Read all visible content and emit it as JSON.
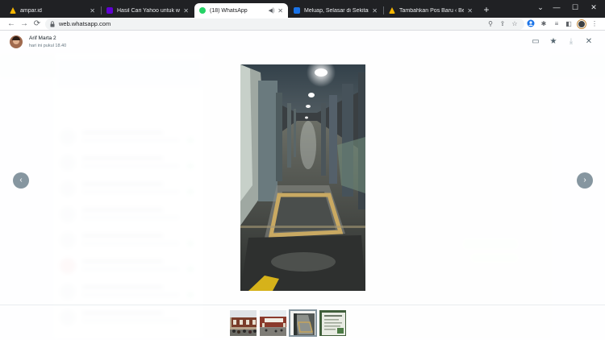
{
  "browser": {
    "tabs": [
      {
        "title": "ampar.id",
        "favicon_color": "#f6b600"
      },
      {
        "title": "Hasil Cari Yahoo untuk whatsapp",
        "favicon_color": "#6001d2"
      },
      {
        "title": "(18) WhatsApp",
        "favicon_color": "#25d366",
        "active": true
      },
      {
        "title": "Meluap, Selasar di Sekitar Gedu",
        "favicon_color": "#1a73e8"
      },
      {
        "title": "Tambahkan Pos Baru ‹ Berita Aktu",
        "favicon_color": "#f6b600"
      }
    ],
    "url": "web.whatsapp.com",
    "icons": {
      "back": "←",
      "forward": "→",
      "reload": "⟳",
      "new_tab": "+",
      "minimize": "—",
      "maximize": "☐",
      "close": "✕",
      "tab_close": "✕",
      "zoom": "⚲",
      "share": "⇪",
      "star": "☆",
      "puzzle": "✱",
      "media": "≡",
      "sidebar": "◧",
      "menu": "⋮",
      "mute": "◀)",
      "collapse": "⌄"
    }
  },
  "viewer": {
    "sender_name": "Arif Marta 2",
    "timestamp": "hari ini pukul 18.40",
    "icons": {
      "reply": "▭",
      "star": "★",
      "download": "⤓",
      "close": "✕",
      "prev": "‹",
      "next": "›"
    },
    "thumbnails": [
      {
        "name": "thumb-building-crowd",
        "selected": false
      },
      {
        "name": "thumb-building-front",
        "selected": false
      },
      {
        "name": "thumb-flooded-walkway",
        "selected": true
      },
      {
        "name": "thumb-green-document",
        "selected": false
      }
    ]
  }
}
